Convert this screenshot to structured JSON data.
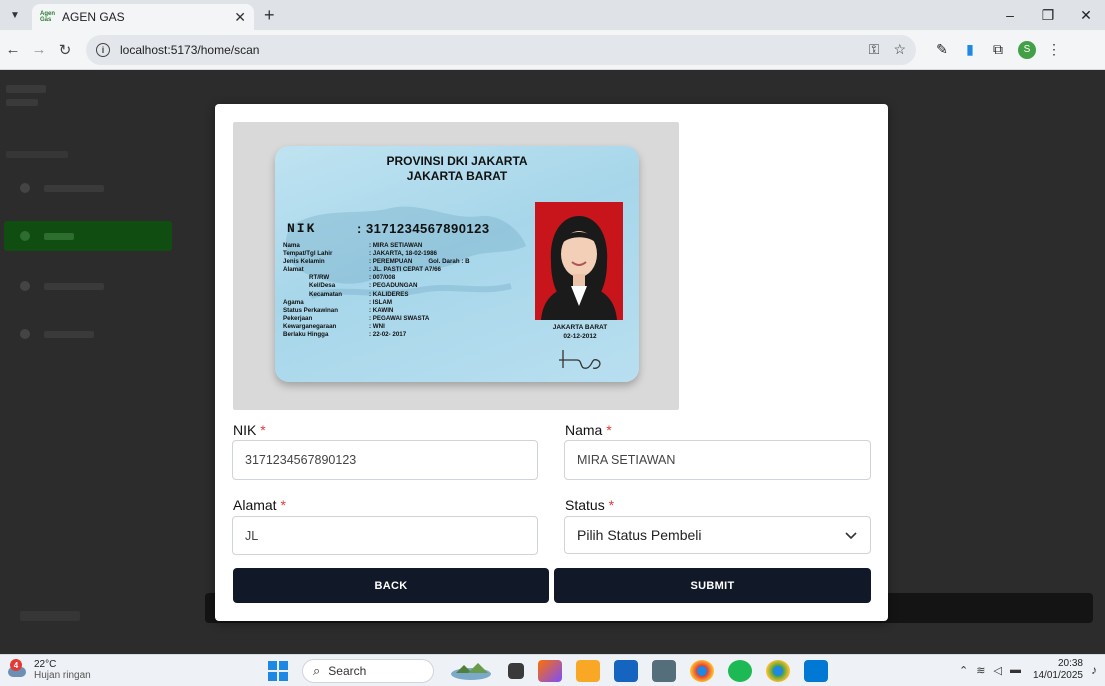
{
  "browser": {
    "tab_title": "AGEN GAS",
    "tab_favicon_text": "Agen Gas",
    "tab_close": "✕",
    "new_tab": "+",
    "url": "localhost:5173/home/scan",
    "window_controls": [
      "–",
      "❐",
      "✕"
    ]
  },
  "ktp": {
    "province": "PROVINSI DKI JAKARTA",
    "city": "JAKARTA BARAT",
    "nik_label": "NIK",
    "nik_value": ": 3171234567890123",
    "fields": [
      {
        "label": "Nama",
        "value": ": MIRA SETIAWAN"
      },
      {
        "label": "Tempat/Tgl Lahir",
        "value": ": JAKARTA, 18-02-1986"
      },
      {
        "label": "Jenis Kelamin",
        "value": ": PEREMPUAN",
        "extra": "Gol. Darah : B"
      },
      {
        "label": "Alamat",
        "value": ": JL. PASTI CEPAT A7/66"
      },
      {
        "label": "RT/RW",
        "value": ": 007/008",
        "indent": true
      },
      {
        "label": "Kel/Desa",
        "value": ": PEGADUNGAN",
        "indent": true
      },
      {
        "label": "Kecamatan",
        "value": ": KALIDERES",
        "indent": true
      },
      {
        "label": "Agama",
        "value": ": ISLAM"
      },
      {
        "label": "Status Perkawinan",
        "value": ": KAWIN"
      },
      {
        "label": "Pekerjaan",
        "value": ": PEGAWAI SWASTA"
      },
      {
        "label": "Kewarganegaraan",
        "value": ": WNI"
      },
      {
        "label": "Berlaku Hingga",
        "value": ": 22-02- 2017"
      }
    ],
    "issue_place": "JAKARTA BARAT",
    "issue_date": "02-12-2012"
  },
  "form": {
    "nik": {
      "label": "NIK",
      "value": "3171234567890123"
    },
    "nama": {
      "label": "Nama",
      "value": "MIRA SETIAWAN"
    },
    "alamat": {
      "label": "Alamat",
      "value": "JL"
    },
    "status": {
      "label": "Status",
      "selected": "Pilih Status Pembeli"
    },
    "required_mark": "*",
    "back_label": "BACK",
    "submit_label": "SUBMIT"
  },
  "taskbar": {
    "weather_temp": "22°C",
    "weather_cond": "Hujan ringan",
    "weather_badge": "4",
    "search_label": "Search",
    "time": "20:38",
    "date": "14/01/2025"
  },
  "colors": {
    "button_bg": "#111827",
    "required": "#e53935",
    "sidebar_active": "#0f4d10"
  }
}
